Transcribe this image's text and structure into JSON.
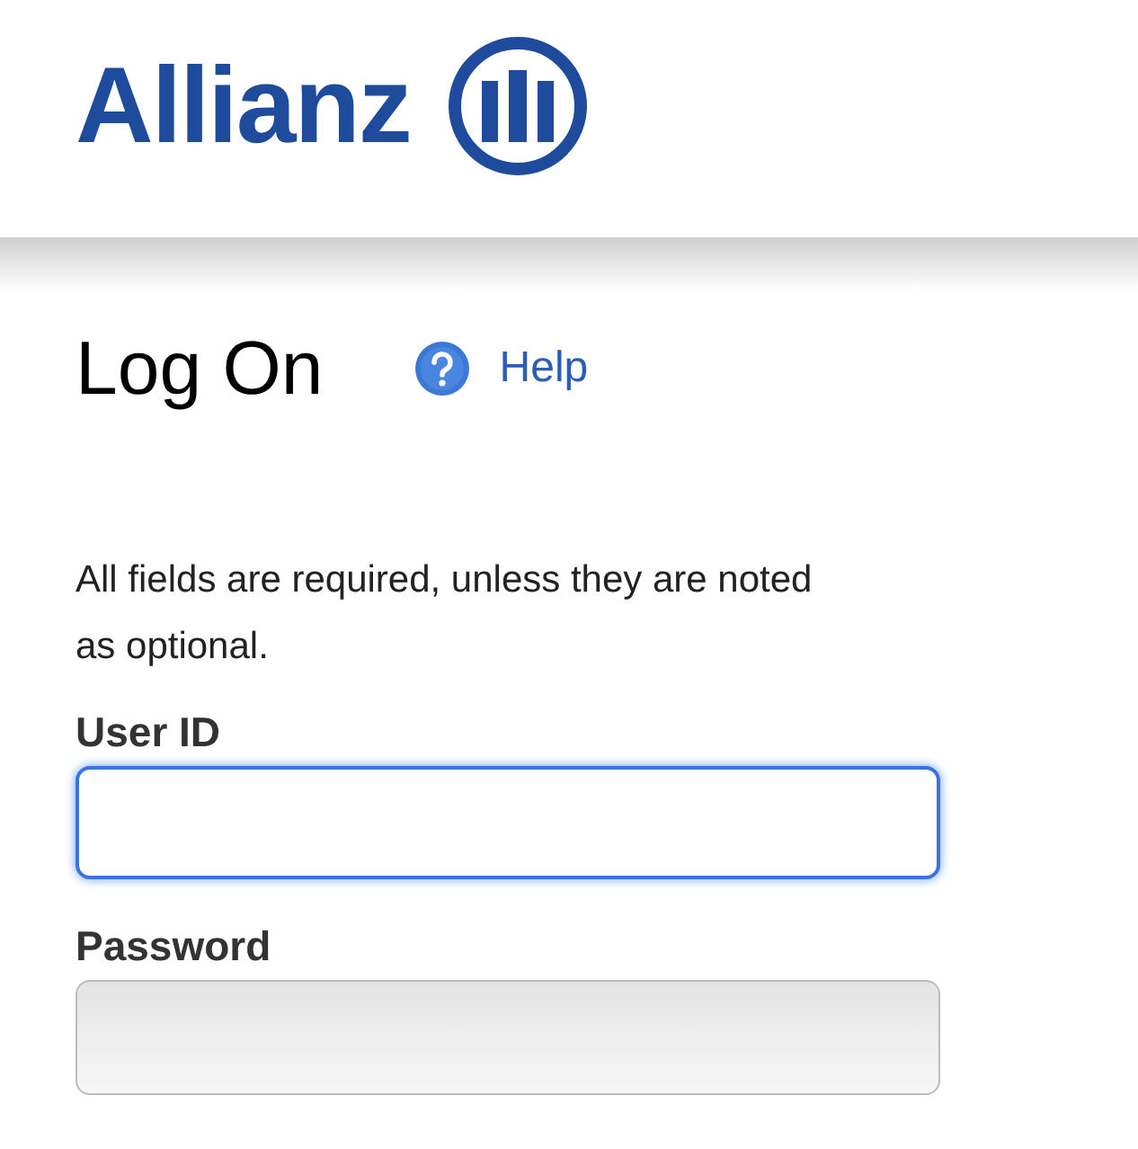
{
  "header": {
    "logo_text": "Allianz"
  },
  "title": "Log On",
  "help_link": "Help",
  "instructions": "All fields are required, unless they are noted as optional.",
  "fields": [
    {
      "label": "User ID",
      "focused": true
    },
    {
      "label": "Password",
      "focused": false
    }
  ]
}
